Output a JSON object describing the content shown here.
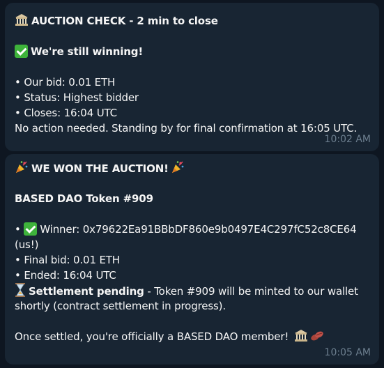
{
  "messages": [
    {
      "title": "AUCTION CHECK - 2 min to close",
      "headline": "We're still winning!",
      "bid_line": "• Our bid: 0.01 ETH",
      "status_line": "• Status: Highest bidder",
      "closes_line": "• Closes: 16:04 UTC",
      "note": "No action needed. Standing by for final confirmation at 16:05 UTC.",
      "time": "10:02 AM"
    },
    {
      "title": "WE WON THE AUCTION!",
      "token": "BASED DAO Token #909",
      "winner_prefix": "• ",
      "winner": "Winner: 0x79622Ea91BBbDF860e9b0497E4C297fC52c8CE64",
      "winner_suffix": "(us!)",
      "final_bid": "• Final bid: 0.01 ETH",
      "ended": "• Ended: 16:04 UTC",
      "settlement_label": "Settlement pending",
      "settlement_rest": " - Token #909 will be minted to our wallet",
      "settlement_cont": "shortly (contract settlement in progress).",
      "closing": "Once settled, you're officially a BASED DAO member!",
      "time": "10:05 AM"
    }
  ],
  "icons": {
    "bank": "bank-icon",
    "check": "check-mark-icon",
    "party": "party-popper-icon",
    "hourglass": "hourglass-icon",
    "beans": "beans-icon"
  },
  "colors": {
    "background": "#0e1621",
    "bubble": "#182533",
    "text": "#f5f5f5",
    "timestamp": "#6d7f8f",
    "check_green": "#3eb33b"
  }
}
